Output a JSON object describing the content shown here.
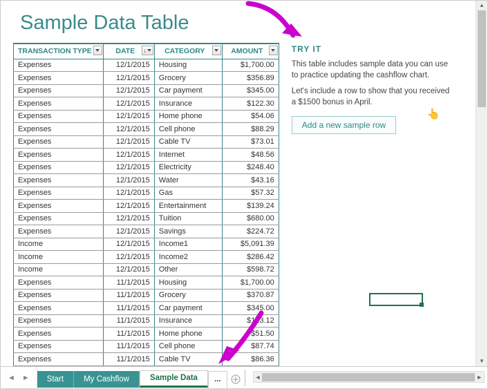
{
  "title": "Sample Data Table",
  "columns": [
    "TRANSACTION TYPE",
    "DATE",
    "CATEGORY",
    "AMOUNT"
  ],
  "rows": [
    {
      "tx": "Expenses",
      "date": "12/1/2015",
      "cat": "Housing",
      "amt": "$1,700.00"
    },
    {
      "tx": "Expenses",
      "date": "12/1/2015",
      "cat": "Grocery",
      "amt": "$356.89"
    },
    {
      "tx": "Expenses",
      "date": "12/1/2015",
      "cat": "Car payment",
      "amt": "$345.00"
    },
    {
      "tx": "Expenses",
      "date": "12/1/2015",
      "cat": "Insurance",
      "amt": "$122.30"
    },
    {
      "tx": "Expenses",
      "date": "12/1/2015",
      "cat": "Home phone",
      "amt": "$54.06"
    },
    {
      "tx": "Expenses",
      "date": "12/1/2015",
      "cat": "Cell phone",
      "amt": "$88.29"
    },
    {
      "tx": "Expenses",
      "date": "12/1/2015",
      "cat": "Cable TV",
      "amt": "$73.01"
    },
    {
      "tx": "Expenses",
      "date": "12/1/2015",
      "cat": "Internet",
      "amt": "$48.56"
    },
    {
      "tx": "Expenses",
      "date": "12/1/2015",
      "cat": "Electricity",
      "amt": "$248.40"
    },
    {
      "tx": "Expenses",
      "date": "12/1/2015",
      "cat": "Water",
      "amt": "$43.16"
    },
    {
      "tx": "Expenses",
      "date": "12/1/2015",
      "cat": "Gas",
      "amt": "$57.32"
    },
    {
      "tx": "Expenses",
      "date": "12/1/2015",
      "cat": "Entertainment",
      "amt": "$139.24"
    },
    {
      "tx": "Expenses",
      "date": "12/1/2015",
      "cat": "Tuition",
      "amt": "$680.00"
    },
    {
      "tx": "Expenses",
      "date": "12/1/2015",
      "cat": "Savings",
      "amt": "$224.72"
    },
    {
      "tx": "Income",
      "date": "12/1/2015",
      "cat": "Income1",
      "amt": "$5,091.39"
    },
    {
      "tx": "Income",
      "date": "12/1/2015",
      "cat": "Income2",
      "amt": "$286.42"
    },
    {
      "tx": "Income",
      "date": "12/1/2015",
      "cat": "Other",
      "amt": "$598.72"
    },
    {
      "tx": "Expenses",
      "date": "11/1/2015",
      "cat": "Housing",
      "amt": "$1,700.00"
    },
    {
      "tx": "Expenses",
      "date": "11/1/2015",
      "cat": "Grocery",
      "amt": "$370.87"
    },
    {
      "tx": "Expenses",
      "date": "11/1/2015",
      "cat": "Car payment",
      "amt": "$345.00"
    },
    {
      "tx": "Expenses",
      "date": "11/1/2015",
      "cat": "Insurance",
      "amt": "$123.12"
    },
    {
      "tx": "Expenses",
      "date": "11/1/2015",
      "cat": "Home phone",
      "amt": "$51.50"
    },
    {
      "tx": "Expenses",
      "date": "11/1/2015",
      "cat": "Cell phone",
      "amt": "$87.74"
    },
    {
      "tx": "Expenses",
      "date": "11/1/2015",
      "cat": "Cable TV",
      "amt": "$86.36"
    }
  ],
  "side": {
    "heading": "TRY IT",
    "p1": "This table includes sample data you can use to practice updating the cashflow chart.",
    "p2": "Let's include a row to show that you received a $1500 bonus in April.",
    "button": "Add a new sample row"
  },
  "tabs": {
    "start": "Start",
    "cashflow": "My Cashflow",
    "sample": "Sample Data",
    "ellipsis": "..."
  },
  "colors": {
    "teal": "#358585",
    "magenta": "#cc00cc",
    "green": "#1f7246"
  }
}
